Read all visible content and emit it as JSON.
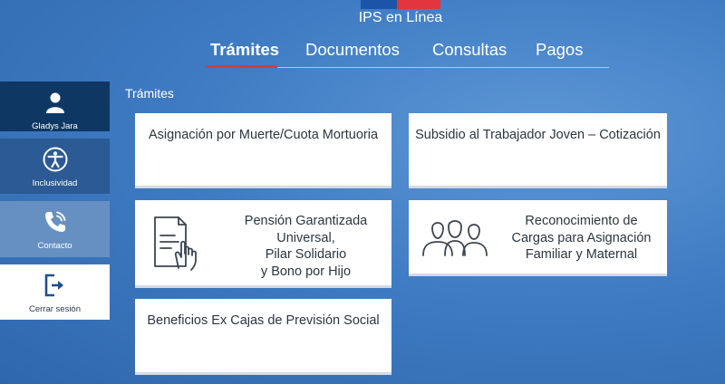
{
  "app": {
    "title": "IPS en Línea",
    "flag_colors": [
      "#1c55a8",
      "#e3353d"
    ]
  },
  "tabs": [
    {
      "label": "Trámites",
      "active": true
    },
    {
      "label": "Documentos",
      "active": false
    },
    {
      "label": "Consultas",
      "active": false
    },
    {
      "label": "Pagos",
      "active": false
    }
  ],
  "sidebar": {
    "items": [
      {
        "label": "Gladys Jara",
        "icon": "user-icon"
      },
      {
        "label": "Inclusividad",
        "icon": "accessibility-icon"
      },
      {
        "label": "Contacto",
        "icon": "phone-icon"
      },
      {
        "label": "Cerrar sesión",
        "icon": "logout-icon"
      }
    ]
  },
  "main": {
    "section_title": "Trámites",
    "cards": [
      {
        "lines": [
          "Asignación por Muerte/Cuota Mortuoria"
        ]
      },
      {
        "lines": [
          "Subsidio al Trabajador Joven – Cotización"
        ]
      },
      {
        "lines": [
          "Pensión Garantizada",
          "Universal,",
          "Pilar Solidario",
          "y Bono por Hijo"
        ],
        "icon": "document-hand-icon"
      },
      {
        "lines": [
          "Reconocimiento de",
          "Cargas para Asignación",
          "Familiar y Maternal"
        ],
        "icon": "family-icon"
      },
      {
        "lines": [
          "Beneficios Ex Cajas de Previsión Social"
        ]
      }
    ]
  },
  "colors": {
    "accent": "#d83a3f",
    "sidebar_dark": "#0f3763",
    "card_text": "#2b3640"
  }
}
